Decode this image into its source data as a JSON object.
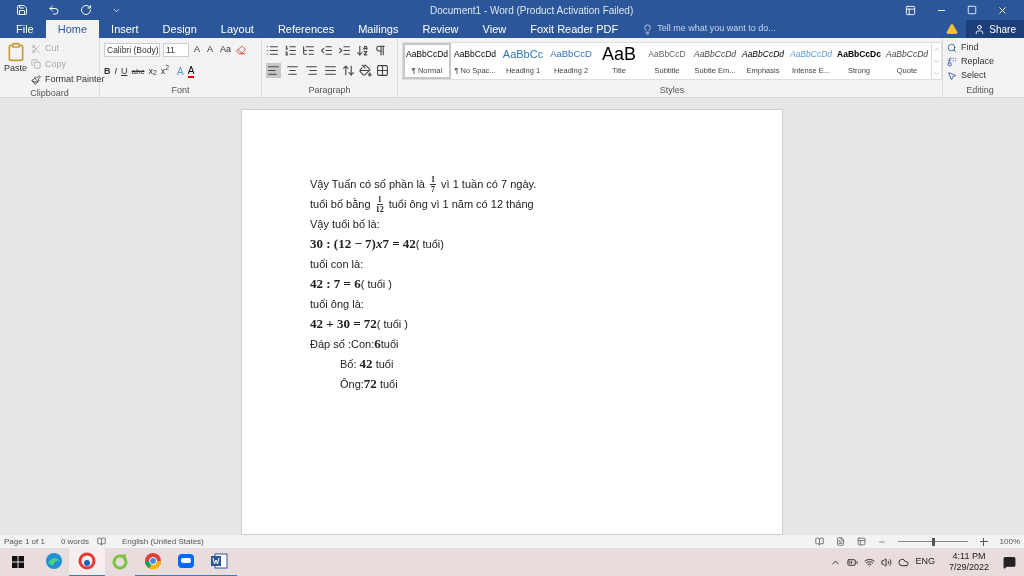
{
  "window": {
    "title": "Document1 - Word (Product Activation Failed)"
  },
  "tabs": [
    {
      "label": "File",
      "selected": false
    },
    {
      "label": "Home",
      "selected": true
    },
    {
      "label": "Insert",
      "selected": false
    },
    {
      "label": "Design",
      "selected": false
    },
    {
      "label": "Layout",
      "selected": false
    },
    {
      "label": "References",
      "selected": false
    },
    {
      "label": "Mailings",
      "selected": false
    },
    {
      "label": "Review",
      "selected": false
    },
    {
      "label": "View",
      "selected": false
    },
    {
      "label": "Foxit Reader PDF",
      "selected": false
    }
  ],
  "tell_me": {
    "placeholder": "Tell me what you want to do..."
  },
  "share": "Share",
  "clipboard": {
    "label": "Clipboard",
    "paste": "Paste",
    "items": [
      {
        "label": "Cut",
        "kind": "cut",
        "disabled": true
      },
      {
        "label": "Copy",
        "kind": "copy",
        "disabled": true
      },
      {
        "label": "Format Painter",
        "kind": "painter",
        "disabled": false
      }
    ]
  },
  "font": {
    "label": "Font",
    "name": "Calibri (Body)",
    "size": "11",
    "size_buttons": [
      "A",
      "A",
      "Aa"
    ],
    "format_buttons": [
      {
        "label": "B",
        "kind": "bold"
      },
      {
        "label": "I",
        "kind": "italic"
      },
      {
        "label": "U",
        "kind": "underline"
      },
      {
        "label": "abc",
        "kind": "strike"
      },
      {
        "label": "x$_{2}$",
        "kind": "sub"
      },
      {
        "label": "x$^{2}$",
        "kind": "sup"
      }
    ],
    "color_buttons": [
      "A",
      "A"
    ]
  },
  "paragraph": {
    "label": "Paragraph",
    "alignment": [
      {
        "kind": "left",
        "selected": true
      },
      {
        "kind": "center",
        "selected": false
      },
      {
        "kind": "right",
        "selected": false
      },
      {
        "kind": "justify",
        "selected": false
      }
    ]
  },
  "styles": {
    "label": "Styles",
    "items": [
      {
        "sample": "AaBbCcDd",
        "name": "¶ Normal",
        "kind": "normal",
        "selected": true
      },
      {
        "sample": "AaBbCcDd",
        "name": "¶ No Spac...",
        "kind": "nospace",
        "selected": false
      },
      {
        "sample": "AaBbCc",
        "name": "Heading 1",
        "kind": "h1",
        "selected": false
      },
      {
        "sample": "AaBbCcD",
        "name": "Heading 2",
        "kind": "h2",
        "selected": false
      },
      {
        "sample": "AaB",
        "name": "Title",
        "kind": "title",
        "selected": false
      },
      {
        "sample": "AaBbCcD",
        "name": "Subtitle",
        "kind": "subtitle",
        "selected": false
      },
      {
        "sample": "AaBbCcDd",
        "name": "Subtle Em...",
        "kind": "subtle",
        "selected": false
      },
      {
        "sample": "AaBbCcDd",
        "name": "Emphasis",
        "kind": "emphasis",
        "selected": false
      },
      {
        "sample": "AaBbCcDd",
        "name": "Intense E...",
        "kind": "intense",
        "selected": false
      },
      {
        "sample": "AaBbCcDc",
        "name": "Strong",
        "kind": "strong",
        "selected": false
      },
      {
        "sample": "AaBbCcDd",
        "name": "Quote",
        "kind": "quote",
        "selected": false
      }
    ]
  },
  "editing": {
    "label": "Editing",
    "items": [
      {
        "label": "Find",
        "kind": "find"
      },
      {
        "label": "Replace",
        "kind": "replace"
      },
      {
        "label": "Select",
        "kind": "select"
      }
    ]
  },
  "document": {
    "lines": [
      {
        "indented": false,
        "parts": [
          {
            "kind": "text",
            "text": "Vậy Tuấn có số phần là "
          },
          {
            "kind": "fraction",
            "numerator": "1",
            "denominator": "7"
          },
          {
            "kind": "text",
            "text": " vì 1 tuần có 7 ngày."
          }
        ]
      },
      {
        "indented": false,
        "parts": [
          {
            "kind": "text",
            "text": "tuổi bố bằng "
          },
          {
            "kind": "fraction",
            "numerator": "1",
            "denominator": "12"
          },
          {
            "kind": "text",
            "text": " tuổi ông vì 1 năm có 12 tháng"
          }
        ]
      },
      {
        "indented": false,
        "parts": [
          {
            "kind": "text",
            "text": "Vậy tuổi bố là:"
          }
        ]
      },
      {
        "indented": false,
        "parts": [
          {
            "kind": "math",
            "text": "30 : (12 − 7)"
          },
          {
            "kind": "variable",
            "text": "x"
          },
          {
            "kind": "math",
            "text": "7 = 42"
          },
          {
            "kind": "text",
            "text": "( tuổi)"
          }
        ]
      },
      {
        "indented": false,
        "parts": [
          {
            "kind": "text",
            "text": "tuổi con là:"
          }
        ]
      },
      {
        "indented": false,
        "parts": [
          {
            "kind": "math",
            "text": "42 : 7 = 6"
          },
          {
            "kind": "text",
            "text": "( tuổi )"
          }
        ]
      },
      {
        "indented": false,
        "parts": [
          {
            "kind": "text",
            "text": "tuổi ông là:"
          }
        ]
      },
      {
        "indented": false,
        "parts": [
          {
            "kind": "math",
            "text": "42 + 30 = 72"
          },
          {
            "kind": "text",
            "text": "( tuổi )"
          }
        ]
      },
      {
        "indented": false,
        "parts": [
          {
            "kind": "text",
            "text": "Đáp số :Con:"
          },
          {
            "kind": "math",
            "text": "6"
          },
          {
            "kind": "text",
            "text": "tuổi"
          }
        ]
      },
      {
        "indented": true,
        "parts": [
          {
            "kind": "text",
            "text": "Bố: "
          },
          {
            "kind": "math",
            "text": "42"
          },
          {
            "kind": "text",
            "text": " tuổi"
          }
        ]
      },
      {
        "indented": true,
        "parts": [
          {
            "kind": "text",
            "text": "Ông:"
          },
          {
            "kind": "math",
            "text": "72"
          },
          {
            "kind": "text",
            "text": " tuổi"
          }
        ]
      }
    ]
  },
  "status_bar": {
    "page": "Page 1 of 1",
    "words": "0 words",
    "language": "English (United States)",
    "zoom": {
      "level": 0.5,
      "reading": "100%"
    }
  },
  "taskbar": {
    "apps": [
      {
        "kind": "edge",
        "open": false,
        "selected": false
      },
      {
        "kind": "tool",
        "open": true,
        "selected": true
      },
      {
        "kind": "leaf",
        "open": false,
        "selected": false
      },
      {
        "kind": "chrome",
        "open": true,
        "selected": false
      },
      {
        "kind": "chat",
        "open": true,
        "selected": false
      },
      {
        "kind": "word",
        "open": true,
        "selected": false
      }
    ],
    "language": "ENG",
    "time": "4:11 PM",
    "date": "7/29/2022"
  }
}
